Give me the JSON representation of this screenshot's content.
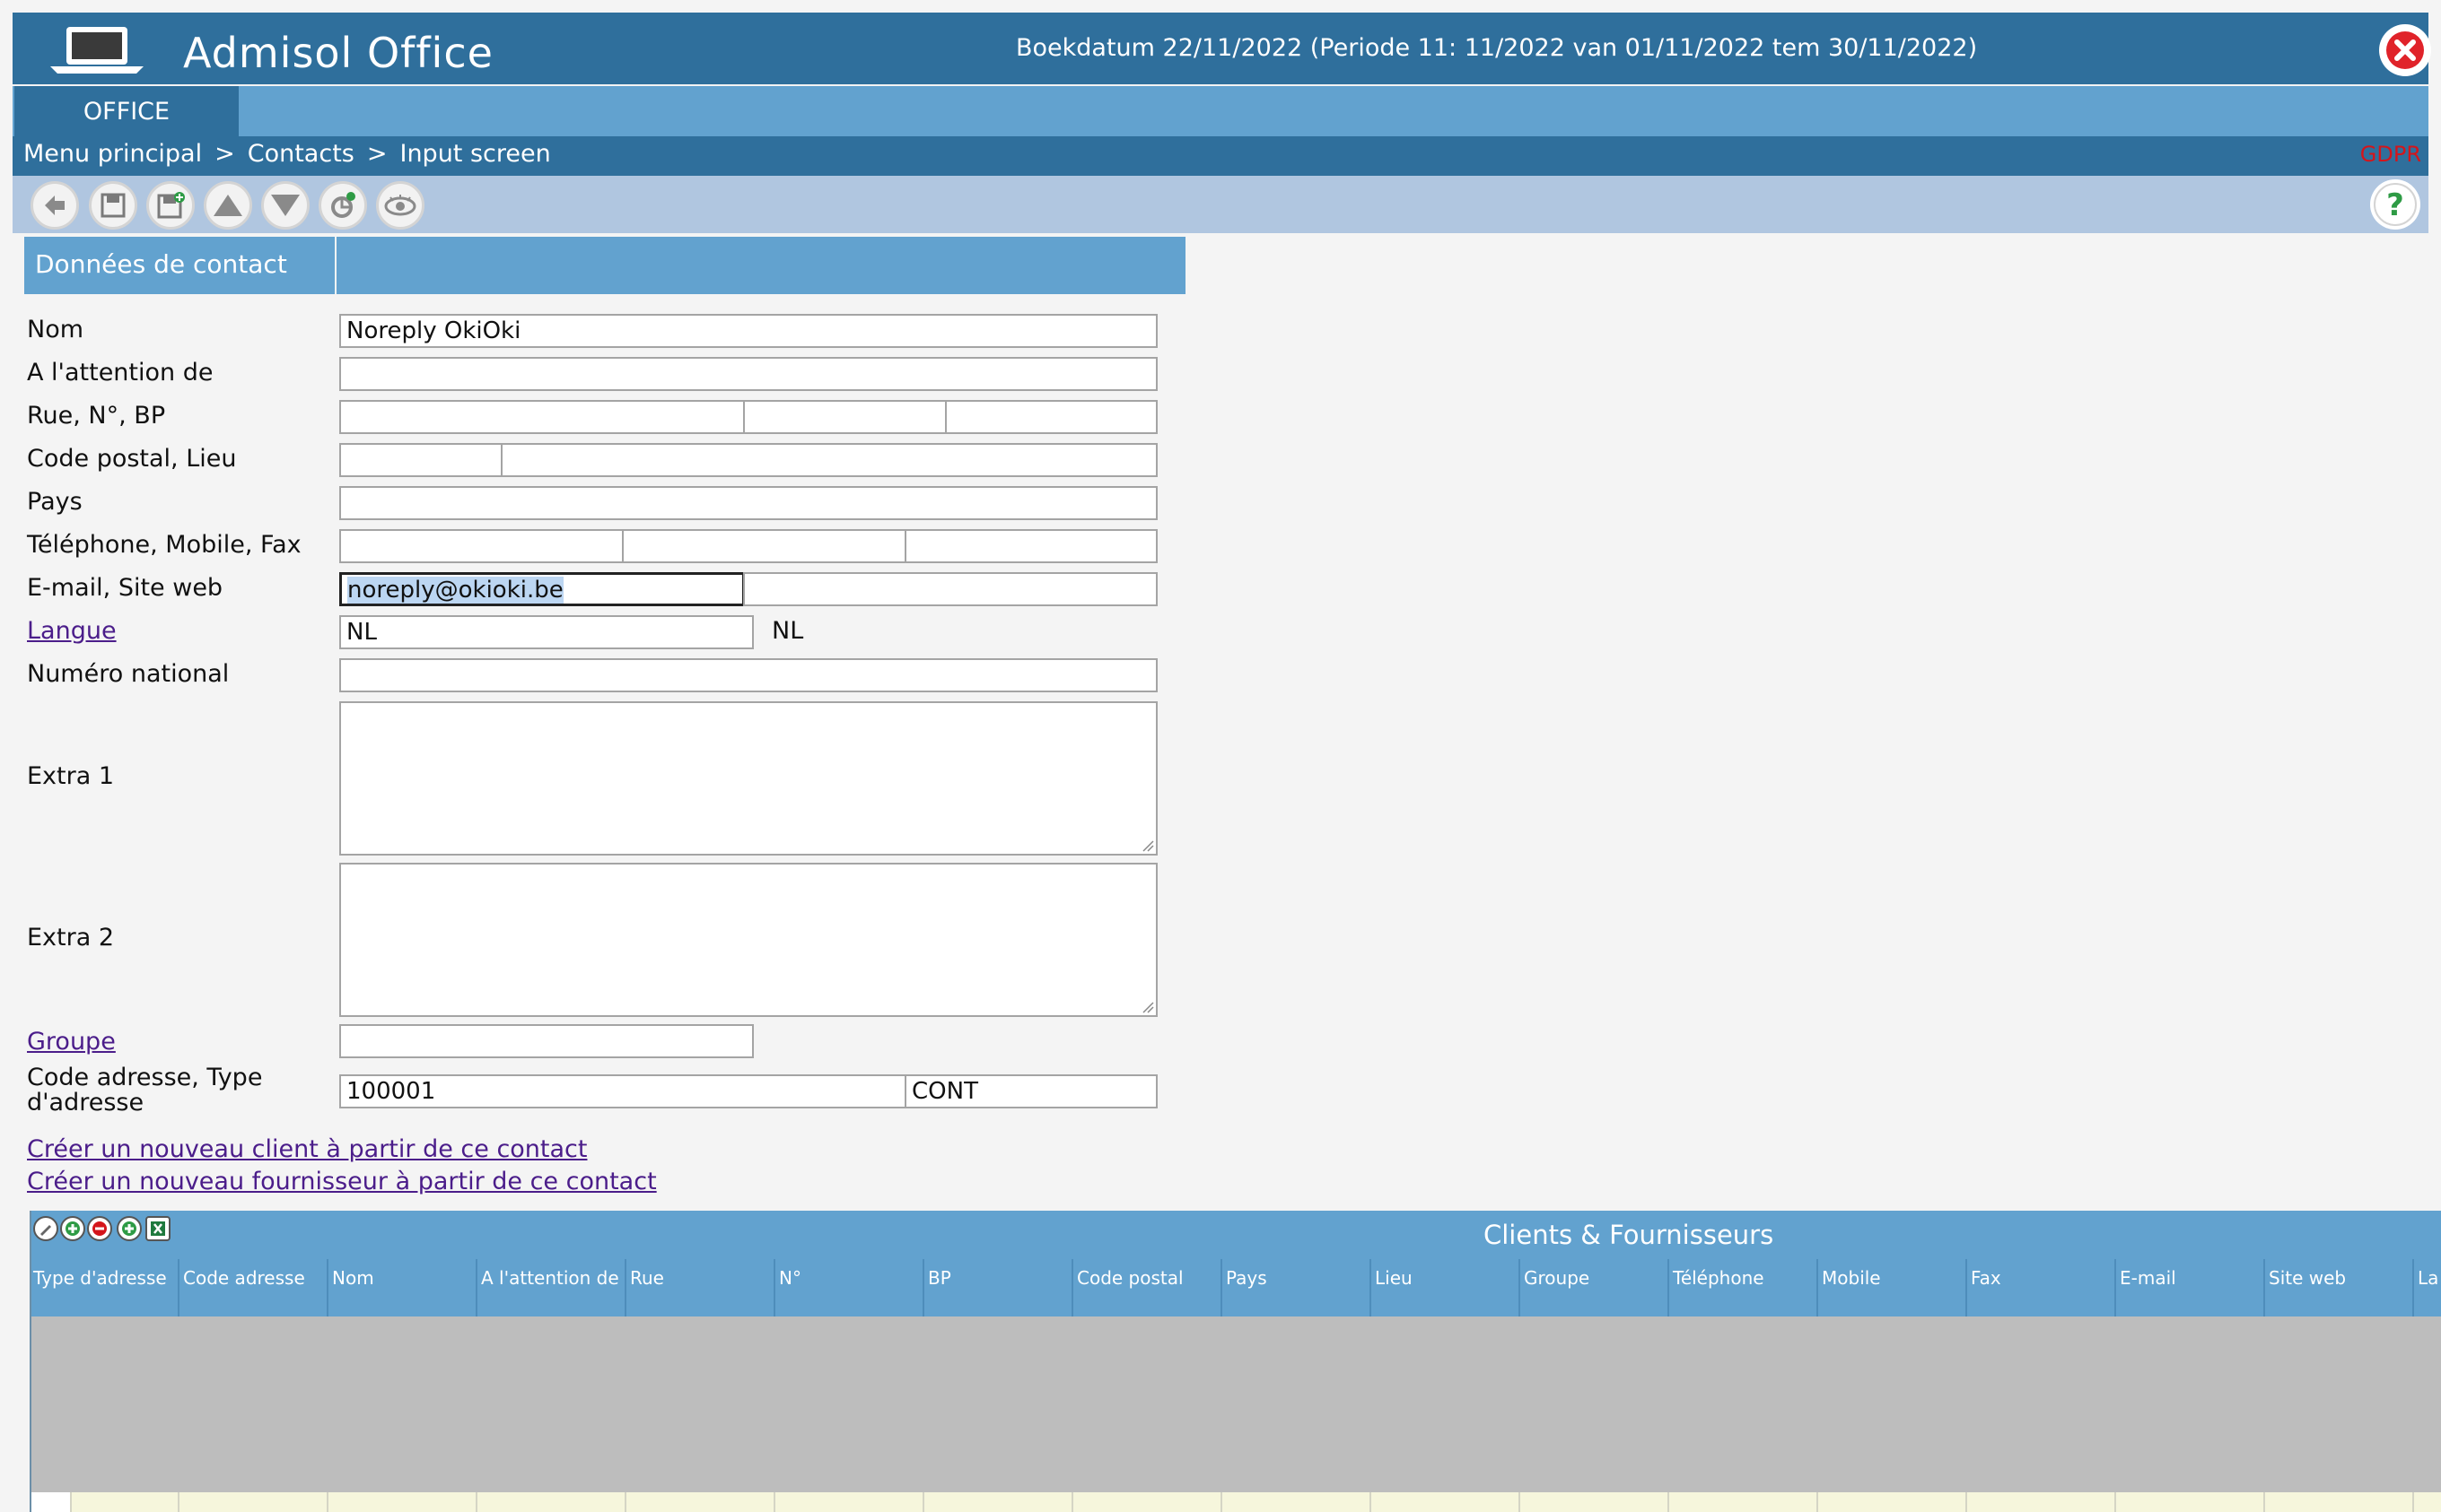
{
  "window": {
    "app_title": "Admisol Office",
    "period_text": "Boekdatum 22/11/2022 (Periode 11: 11/2022 van 01/11/2022 tem 30/11/2022)",
    "close_icon": "close-icon",
    "laptop_icon": "laptop-icon"
  },
  "tabs": [
    {
      "label": "OFFICE",
      "active": true
    }
  ],
  "breadcrumb": [
    "Menu principal",
    "Contacts",
    "Input screen"
  ],
  "breadcrumb_sep": ">",
  "gdpr_label": "GDPR",
  "toolbar": {
    "icons": [
      "back-icon",
      "save-icon",
      "save-new-icon",
      "up-arrow-icon",
      "down-arrow-icon",
      "refresh-icon",
      "view-icon",
      "help-icon"
    ]
  },
  "section": {
    "title": "Données de contact"
  },
  "form": {
    "nom_label": "Nom",
    "nom_value": "Noreply OkiOki",
    "attention_label": "A l'attention de",
    "attention_value": "",
    "rue_label": "Rue, N°, BP",
    "code_postal_label": "Code postal, Lieu",
    "pays_label": "Pays",
    "telephone_label": "Téléphone, Mobile, Fax",
    "email_label": "E-mail, Site web",
    "email_value": "noreply@okioki.be",
    "langue_label": "Langue",
    "langue_value": "NL",
    "langue_display": "NL",
    "numero_national_label": "Numéro national",
    "extra1_label": "Extra 1",
    "extra2_label": "Extra 2",
    "groupe_label": "Groupe",
    "code_adresse_label": "Code adresse, Type d'adresse",
    "code_adresse_value": "100001",
    "type_adresse_value": "CONT"
  },
  "links": {
    "create_client": "Créer un nouveau client à partir de ce contact",
    "create_supplier": "Créer un nouveau fournisseur à partir de ce contact"
  },
  "grid": {
    "title": "Clients & Fournisseurs",
    "tool_icons": [
      "edit-icon",
      "add-icon",
      "remove-icon",
      "add-alt-icon",
      "excel-icon"
    ],
    "columns": [
      "Type d'adresse",
      "Code adresse",
      "Nom",
      "A l'attention de",
      "Rue",
      "N°",
      "BP",
      "Code postal",
      "Pays",
      "Lieu",
      "Groupe",
      "Téléphone",
      "Mobile",
      "Fax",
      "E-mail",
      "Site web",
      "La"
    ]
  },
  "colors": {
    "title_bar": "#2f6f9c",
    "tab_strip": "#62a2cf",
    "toolbar": "#b0c6e0",
    "grid_body": "#bdbdbd",
    "gdpr": "#d4151b",
    "link": "#4b1d8a"
  }
}
